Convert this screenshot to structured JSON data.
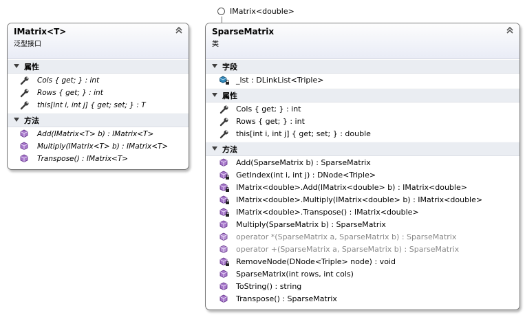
{
  "interface_marker": {
    "label": "IMatrix<double>"
  },
  "interface_box": {
    "title": "IMatrix<T>",
    "subtitle": "泛型接口",
    "sections": [
      {
        "label": "属性",
        "items": [
          {
            "icon": "wrench-icon",
            "text": "Cols { get; } : int"
          },
          {
            "icon": "wrench-icon",
            "text": "Rows { get; } : int"
          },
          {
            "icon": "wrench-icon",
            "text": "this[int i, int j] { get; set; } : T"
          }
        ]
      },
      {
        "label": "方法",
        "items": [
          {
            "icon": "method-icon",
            "text": "Add(IMatrix<T> b) : IMatrix<T>"
          },
          {
            "icon": "method-icon",
            "text": "Multiply(IMatrix<T> b) : IMatrix<T>"
          },
          {
            "icon": "method-icon",
            "text": "Transpose() : IMatrix<T>"
          }
        ]
      }
    ]
  },
  "class_box": {
    "title": "SparseMatrix",
    "subtitle": "类",
    "sections": [
      {
        "label": "字段",
        "items": [
          {
            "icon": "private-field-icon",
            "text": "_lst : DLinkList<Triple>"
          }
        ]
      },
      {
        "label": "属性",
        "items": [
          {
            "icon": "wrench-icon",
            "text": "Cols { get; } : int"
          },
          {
            "icon": "wrench-icon",
            "text": "Rows { get; } : int"
          },
          {
            "icon": "wrench-icon",
            "text": "this[int i, int j] { get; set; } : double"
          }
        ]
      },
      {
        "label": "方法",
        "items": [
          {
            "icon": "method-icon",
            "text": "Add(SparseMatrix b) : SparseMatrix"
          },
          {
            "icon": "private-method-icon",
            "text": "GetIndex(int i, int j) : DNode<Triple>"
          },
          {
            "icon": "private-method-icon",
            "text": "IMatrix<double>.Add(IMatrix<double> b) : IMatrix<double>"
          },
          {
            "icon": "private-method-icon",
            "text": "IMatrix<double>.Multiply(IMatrix<double> b) : IMatrix<double>"
          },
          {
            "icon": "private-method-icon",
            "text": "IMatrix<double>.Transpose() : IMatrix<double>"
          },
          {
            "icon": "method-icon",
            "text": "Multiply(SparseMatrix b) : SparseMatrix"
          },
          {
            "icon": "static-method-icon",
            "text": "operator *(SparseMatrix a, SparseMatrix b) : SparseMatrix",
            "dim": true
          },
          {
            "icon": "static-method-icon",
            "text": "operator +(SparseMatrix a, SparseMatrix b) : SparseMatrix",
            "dim": true
          },
          {
            "icon": "private-method-icon",
            "text": "RemoveNode(DNode<Triple> node) : void"
          },
          {
            "icon": "method-icon",
            "text": "SparseMatrix(int rows, int cols)"
          },
          {
            "icon": "method-icon",
            "text": "ToString() : string"
          },
          {
            "icon": "method-icon",
            "text": "Transpose() : SparseMatrix"
          }
        ]
      }
    ]
  }
}
